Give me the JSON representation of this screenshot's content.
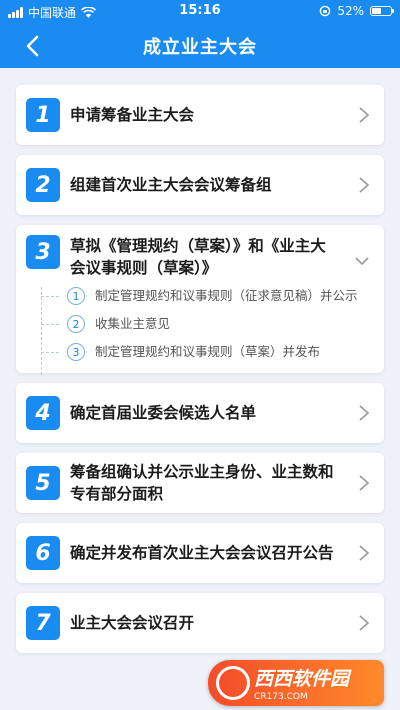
{
  "status_bar": {
    "carrier": "中国联通",
    "time": "15:16",
    "battery": "52%",
    "battery_level": 0.52
  },
  "header": {
    "title": "成立业主大会"
  },
  "steps": [
    {
      "number": "1",
      "title": "申请筹备业主大会"
    },
    {
      "number": "2",
      "title": "组建首次业主大会会议筹备组"
    },
    {
      "number": "3",
      "title": "草拟《管理规约（草案）》和《业主大会议事规则（草案）》",
      "expanded": true,
      "substeps": [
        {
          "number": "1",
          "text": "制定管理规约和议事规则（征求意见稿）并公示"
        },
        {
          "number": "2",
          "text": "收集业主意见"
        },
        {
          "number": "3",
          "text": "制定管理规约和议事规则（草案）并发布"
        }
      ]
    },
    {
      "number": "4",
      "title": "确定首届业委会候选人名单"
    },
    {
      "number": "5",
      "title": "筹备组确认并公示业主身份、业主数和专有部分面积"
    },
    {
      "number": "6",
      "title": "确定并发布首次业主大会会议召开公告"
    },
    {
      "number": "7",
      "title": "业主大会会议召开"
    }
  ],
  "watermark": {
    "main": "西西软件园",
    "sub": "CR173.COM"
  },
  "colors": {
    "primary": "#1a8bf0",
    "background": "#eef2f8"
  }
}
